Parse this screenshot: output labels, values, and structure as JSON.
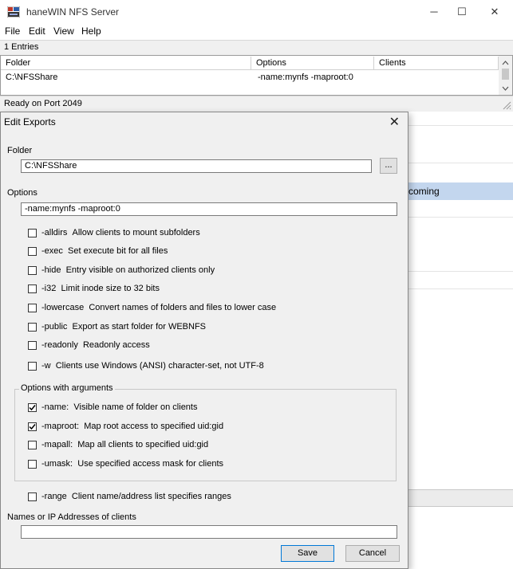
{
  "app": {
    "title": "haneWIN NFS Server",
    "icon": "app-icon",
    "window_buttons": {
      "minimize": "─",
      "maximize": "☐",
      "close": "✕"
    },
    "menu": [
      "File",
      "Edit",
      "View",
      "Help"
    ],
    "entries_count": "1 Entries",
    "table": {
      "columns": [
        "Folder",
        "Options",
        "Clients"
      ],
      "rows": [
        {
          "folder": "C:\\NFSShare",
          "options": "-name:mynfs -maproot:0",
          "clients": ""
        }
      ]
    },
    "status": "Ready on Port 2049",
    "background_selected_text": "coming"
  },
  "dialog": {
    "title": "Edit Exports",
    "close_glyph": "✕",
    "folder_label": "Folder",
    "folder_value": "C:\\NFSShare",
    "browse_label": "...",
    "options_label": "Options",
    "options_value": "-name:mynfs -maproot:0",
    "options": [
      {
        "flag": "-alldirs",
        "desc": "Allow clients to mount subfolders",
        "checked": false
      },
      {
        "flag": "-exec",
        "desc": "Set execute bit for all files",
        "checked": false
      },
      {
        "flag": "-hide",
        "desc": "Entry visible on authorized clients only",
        "checked": false
      },
      {
        "flag": "-i32",
        "desc": "Limit inode size to 32 bits",
        "checked": false
      },
      {
        "flag": "-lowercase",
        "desc": "Convert names of folders and files to lower case",
        "checked": false
      },
      {
        "flag": "-public",
        "desc": "Export as start folder for WEBNFS",
        "checked": false
      },
      {
        "flag": "-readonly",
        "desc": "Readonly access",
        "checked": false
      },
      {
        "flag": "-w",
        "desc": "Clients use Windows (ANSI) character-set, not UTF-8",
        "checked": false
      }
    ],
    "group_label": "Options with arguments",
    "arg_options": [
      {
        "flag": "-name:",
        "desc": "Visible name of folder on clients",
        "checked": true
      },
      {
        "flag": "-maproot:",
        "desc": "Map root access to specified uid:gid",
        "checked": true
      },
      {
        "flag": "-mapall:",
        "desc": "Map all clients to specified  uid:gid",
        "checked": false
      },
      {
        "flag": "-umask:",
        "desc": "Use specified access mask for clients",
        "checked": false
      }
    ],
    "range_option": {
      "flag": "-range",
      "desc": "Client name/address list specifies ranges",
      "checked": false
    },
    "clients_label": "Names or IP Addresses of clients",
    "clients_value": "",
    "save_label": "Save",
    "cancel_label": "Cancel"
  },
  "colors": {
    "selected_row": "#c3d6ee",
    "default_button_border": "#0078d7",
    "dialog_bg": "#f0f0f0"
  }
}
